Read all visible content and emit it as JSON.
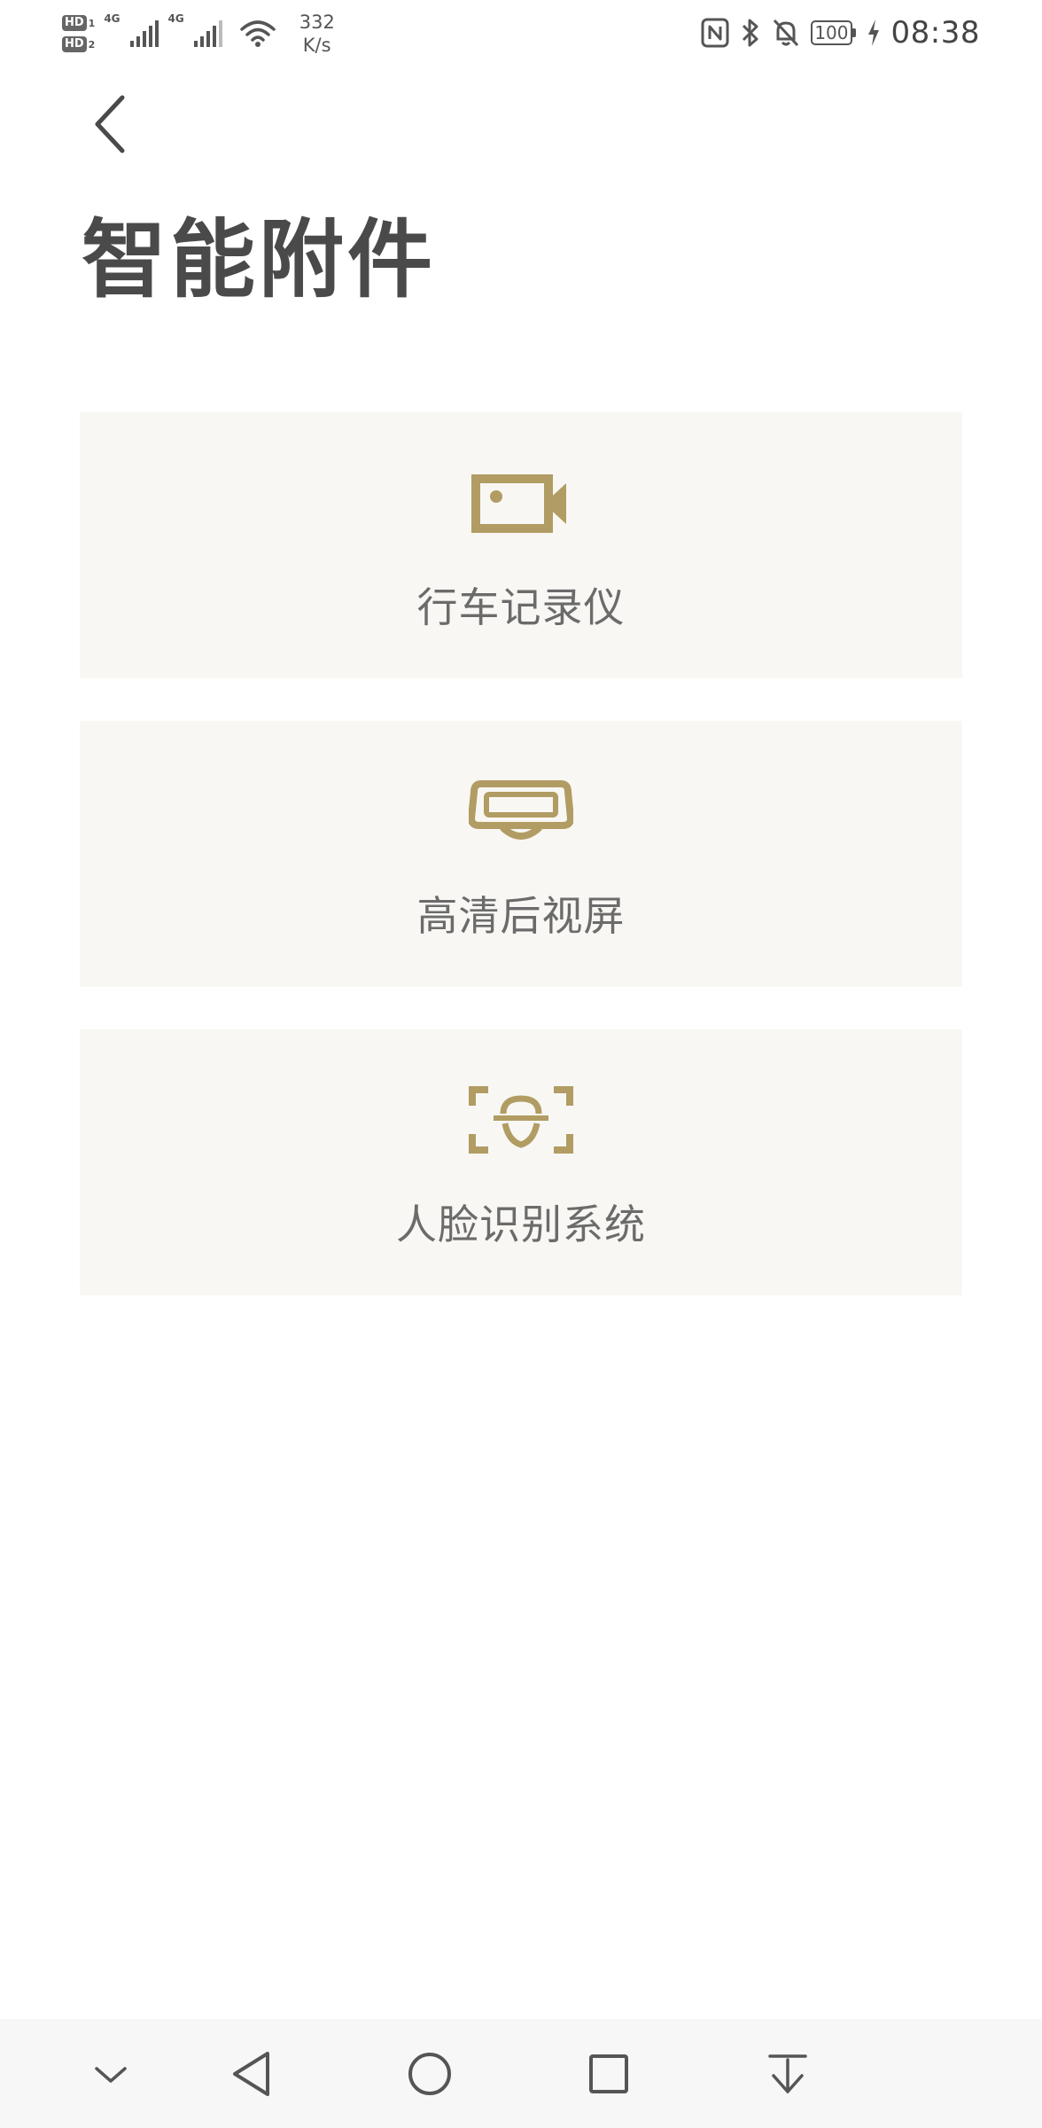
{
  "status_bar": {
    "sim1_label": "HD",
    "sim1_index": "1",
    "sim2_label": "HD",
    "sim2_index": "2",
    "network1": "4G",
    "network2": "4G",
    "speed_value": "332",
    "speed_unit": "K/s",
    "battery": "100",
    "time": "08:38",
    "icons": [
      "nfc-icon",
      "bluetooth-icon",
      "bell-off-icon",
      "battery-icon",
      "charging-icon"
    ]
  },
  "header": {
    "back_icon": "chevron-left-icon",
    "title": "智能附件"
  },
  "accessories": [
    {
      "label": "行车记录仪",
      "icon": "video-camera-icon"
    },
    {
      "label": "高清后视屏",
      "icon": "rearview-screen-icon"
    },
    {
      "label": "人脸识别系统",
      "icon": "face-scan-icon"
    }
  ],
  "nav_bar": {
    "buttons": [
      "collapse-icon",
      "back-triangle-icon",
      "home-circle-icon",
      "recents-square-icon",
      "notification-pull-icon"
    ]
  },
  "colors": {
    "accent": "#b19c63",
    "card_background": "#f8f7f3",
    "title_text": "#4a4a4a",
    "label_text": "#6b6b6b"
  }
}
